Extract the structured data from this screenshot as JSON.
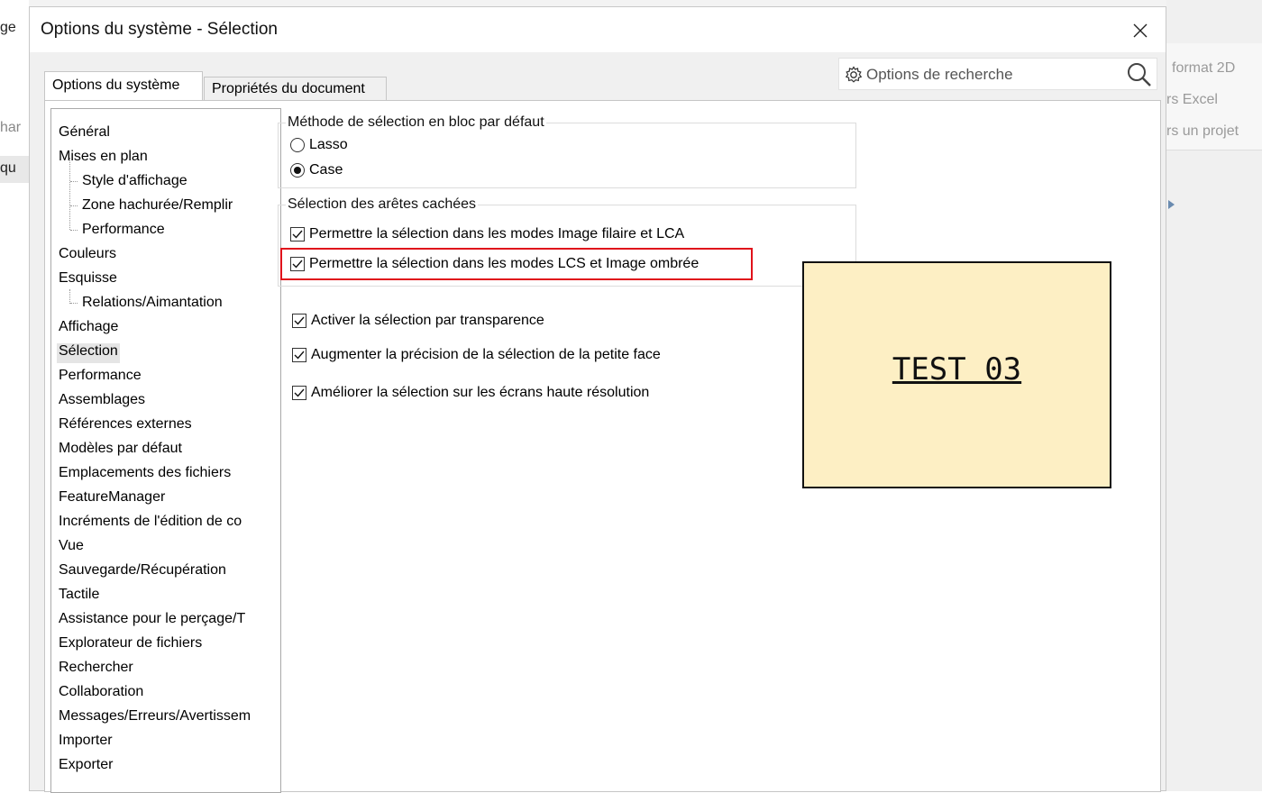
{
  "background": {
    "left_texts": [
      "ge",
      "har",
      "qu"
    ],
    "right_texts": [
      "format 2D",
      "rs Excel",
      "rs un projet"
    ]
  },
  "dialog": {
    "title": "Options du système - Sélection",
    "close_icon": "close-icon",
    "search_placeholder": "Options de recherche",
    "tabs": [
      {
        "label": "Options du système",
        "active": true
      },
      {
        "label": "Propriétés du document",
        "active": false
      }
    ],
    "tree": [
      {
        "label": "Général",
        "level": 0
      },
      {
        "label": "Mises en plan",
        "level": 0
      },
      {
        "label": "Style d'affichage",
        "level": 1
      },
      {
        "label": "Zone hachurée/Remplir",
        "level": 1
      },
      {
        "label": "Performance",
        "level": 1
      },
      {
        "label": "Couleurs",
        "level": 0
      },
      {
        "label": "Esquisse",
        "level": 0
      },
      {
        "label": "Relations/Aimantation",
        "level": 1
      },
      {
        "label": "Affichage",
        "level": 0
      },
      {
        "label": "Sélection",
        "level": 0,
        "selected": true
      },
      {
        "label": "Performance",
        "level": 0
      },
      {
        "label": "Assemblages",
        "level": 0
      },
      {
        "label": "Références externes",
        "level": 0
      },
      {
        "label": "Modèles par défaut",
        "level": 0
      },
      {
        "label": "Emplacements des fichiers",
        "level": 0
      },
      {
        "label": "FeatureManager",
        "level": 0
      },
      {
        "label": "Incréments de l'édition de co",
        "level": 0
      },
      {
        "label": "Vue",
        "level": 0
      },
      {
        "label": "Sauvegarde/Récupération",
        "level": 0
      },
      {
        "label": "Tactile",
        "level": 0
      },
      {
        "label": "Assistance pour le perçage/T",
        "level": 0
      },
      {
        "label": "Explorateur de fichiers",
        "level": 0
      },
      {
        "label": "Rechercher",
        "level": 0
      },
      {
        "label": "Collaboration",
        "level": 0
      },
      {
        "label": "Messages/Erreurs/Avertissem",
        "level": 0
      },
      {
        "label": "Importer",
        "level": 0
      },
      {
        "label": "Exporter",
        "level": 0
      }
    ],
    "block_selection": {
      "label": "Méthode de sélection en bloc par défaut",
      "options": [
        {
          "label": "Lasso",
          "selected": false
        },
        {
          "label": "Case",
          "selected": true
        }
      ]
    },
    "hidden_edges": {
      "label": "Sélection des arêtes cachées",
      "options": [
        {
          "label": "Permettre la sélection dans les modes Image filaire et LCA",
          "checked": true
        },
        {
          "label": "Permettre la sélection dans les modes LCS et Image ombrée",
          "checked": true,
          "highlighted": true
        }
      ]
    },
    "other_options": [
      {
        "label": "Activer la sélection par transparence",
        "checked": true
      },
      {
        "label": "Augmenter la précision de la sélection de la petite face",
        "checked": true
      },
      {
        "label": "Améliorer la sélection sur les écrans haute résolution",
        "checked": true
      }
    ]
  },
  "note": {
    "label": "TEST 03",
    "color": "#fdefc4"
  },
  "colors": {
    "highlight": "#e0121b",
    "selected_bg": "#e5e5e5"
  }
}
